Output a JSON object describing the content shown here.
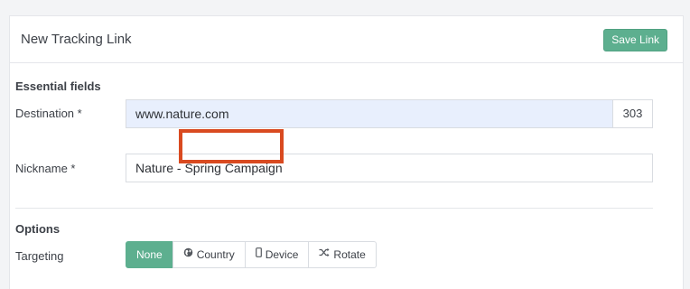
{
  "panel": {
    "title": "New Tracking Link",
    "save_label": "Save Link"
  },
  "essential": {
    "heading": "Essential fields",
    "destination": {
      "label": "Destination *",
      "value": "www.nature.com",
      "addon": "303"
    },
    "nickname": {
      "label": "Nickname *",
      "value": "Nature - Spring Campaign"
    }
  },
  "options": {
    "heading": "Options",
    "targeting": {
      "label": "Targeting",
      "selected": "None",
      "buttons": [
        {
          "label": "None",
          "icon": ""
        },
        {
          "label": "Country",
          "icon": "globe-icon"
        },
        {
          "label": "Device",
          "icon": "mobile-icon"
        },
        {
          "label": "Rotate",
          "icon": "shuffle-icon"
        }
      ]
    }
  },
  "colors": {
    "accent": "#5daf8f",
    "highlight": "#d94a20",
    "destination_bg": "#e8effd"
  }
}
